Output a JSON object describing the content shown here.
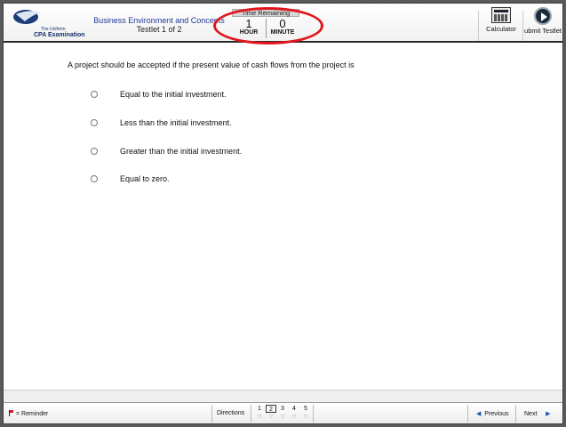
{
  "header": {
    "logo_line1": "The Uniform",
    "logo_line2": "CPA Examination",
    "exam_title": "Business Environment and Concepts",
    "testlet": "Testlet 1 of 2",
    "timer": {
      "label": "Time Remaining",
      "hours": "1",
      "hours_unit": "HOUR",
      "minutes": "0",
      "minutes_unit": "MINUTE"
    },
    "tools": {
      "calculator_label": "Calculator",
      "submit_label": "Submit Testlet"
    }
  },
  "question": {
    "text": "A project should be accepted if the present value of cash flows from the project is",
    "options": [
      "Equal to the initial investment.",
      "Less than the initial investment.",
      "Greater than the initial investment.",
      "Equal to zero."
    ]
  },
  "footer": {
    "reminder_label": "= Reminder",
    "directions_label": "Directions",
    "questions": [
      "1",
      "2",
      "3",
      "4",
      "5"
    ],
    "current_question": "2",
    "previous_label": "Previous",
    "next_label": "Next"
  },
  "colors": {
    "title_blue": "#1f3a93",
    "highlight_ring": "#e0161c",
    "nav_arrow": "#1a55b5"
  }
}
